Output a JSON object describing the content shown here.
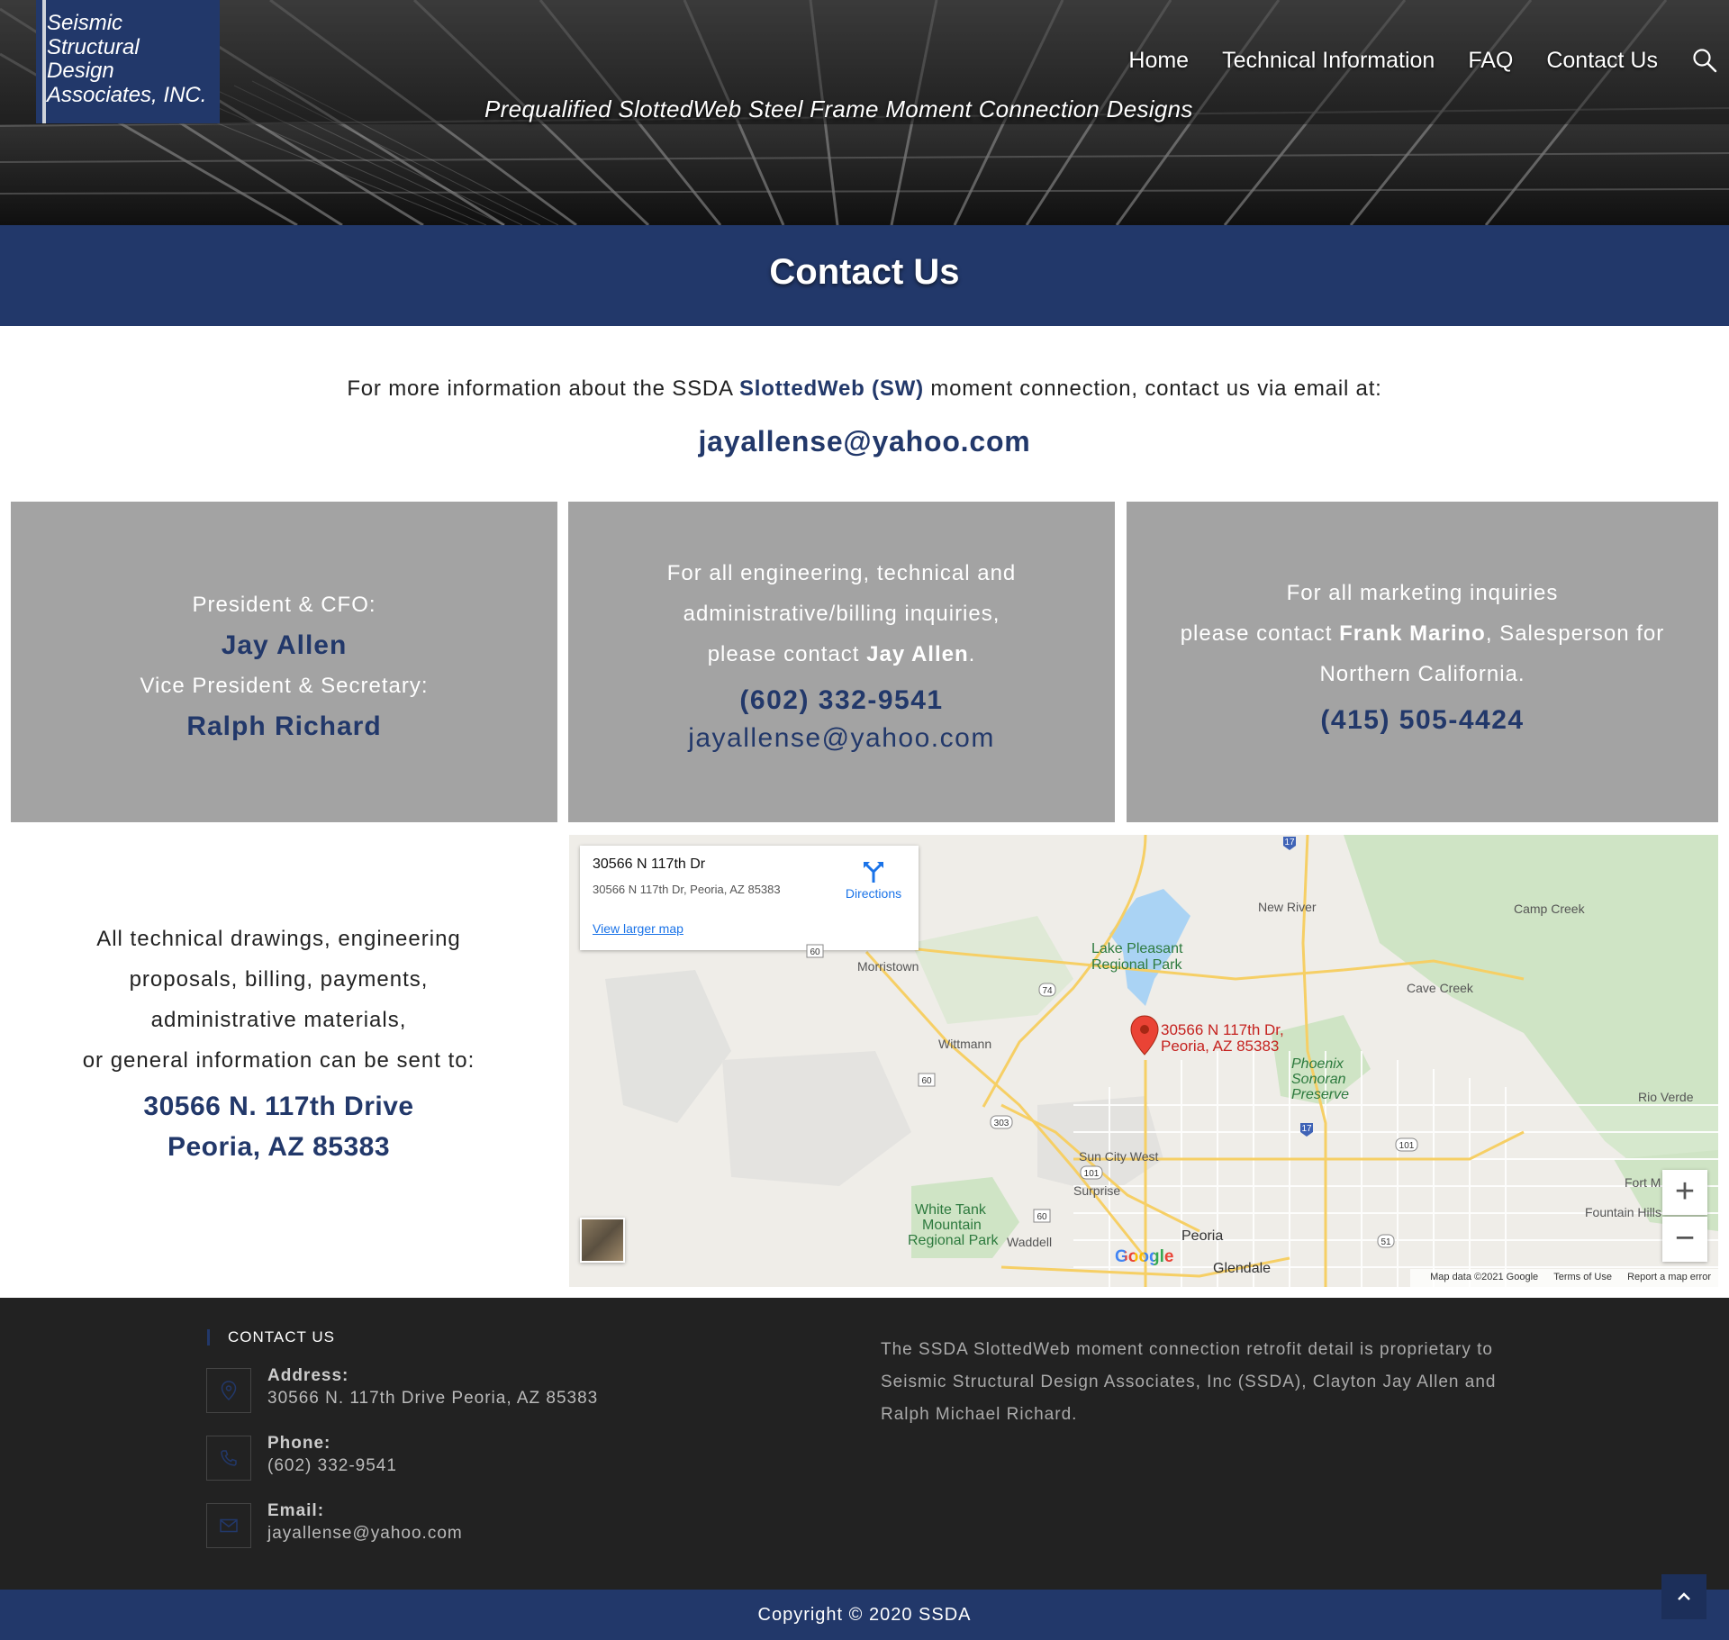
{
  "header": {
    "logo_lines": [
      {
        "initial": "S",
        "rest": "eismic"
      },
      {
        "initial": "S",
        "rest": "tructural"
      },
      {
        "initial": "D",
        "rest": "esign"
      },
      {
        "initial": "A",
        "rest": "ssociates, INC."
      }
    ],
    "nav": [
      "Home",
      "Technical Information",
      "FAQ",
      "Contact Us"
    ],
    "search_icon": "search-icon",
    "tagline": "Prequalified SlottedWeb Steel Frame Moment Connection Designs"
  },
  "page_title": "Contact Us",
  "intro": {
    "prefix": "For more information about the SSDA ",
    "brand": "SlottedWeb (SW)",
    "suffix": " moment connection, contact us via email at:",
    "email": "jayallense@yahoo.com"
  },
  "cards": {
    "officers": {
      "role1": "President & CFO:",
      "name1": "Jay Allen",
      "role2": "Vice President & Secretary:",
      "name2": "Ralph Richard"
    },
    "engineering": {
      "line1": "For all engineering, technical and",
      "line2": "administrative/billing inquiries,",
      "line3_prefix": "please contact ",
      "line3_name": "Jay Allen",
      "line3_suffix": ".",
      "phone": "(602) 332-9541",
      "email": "jayallense@yahoo.com"
    },
    "marketing": {
      "line1": "For all marketing inquiries",
      "line2_prefix": "please contact ",
      "line2_name": "Frank Marino",
      "line2_suffix": ", Salesperson for",
      "line3": "Northern California.",
      "phone": "(415) 505-4424"
    }
  },
  "mail": {
    "lines": [
      "All technical drawings, engineering",
      "proposals, billing, payments,",
      "administrative materials,",
      "or general information can be sent to:"
    ],
    "address1": "30566 N. 117th Drive",
    "address2": "Peoria, AZ 85383"
  },
  "map": {
    "info_title": "30566 N 117th Dr",
    "info_sub": "30566 N 117th Dr, Peoria, AZ 85383",
    "directions": "Directions",
    "larger": "View larger map",
    "marker_line1": "30566 N 117th Dr,",
    "marker_line2": "Peoria, AZ 85383",
    "labels": {
      "new_river": "New River",
      "camp_creek": "Camp Creek",
      "lake_pleasant_1": "Lake Pleasant",
      "lake_pleasant_2": "Regional Park",
      "morristown": "Morristown",
      "cave_creek": "Cave Creek",
      "wittmann": "Wittmann",
      "phoenix_1": "Phoenix",
      "phoenix_2": "Sonoran",
      "phoenix_3": "Preserve",
      "rio_verde": "Rio Verde",
      "sun_city_west": "Sun City West",
      "surprise": "Surprise",
      "fort_m": "Fort M",
      "fountain_hills": "Fountain Hills",
      "white_tank_1": "White Tank",
      "white_tank_2": "Mountain",
      "white_tank_3": "Regional Park",
      "waddell": "Waddell",
      "peoria": "Peoria",
      "glendale": "Glendale"
    },
    "shields": [
      "17",
      "74",
      "60",
      "303",
      "101",
      "17",
      "101",
      "60",
      "51",
      "60"
    ],
    "google": "Google",
    "map_data": "Map data ©2021 Google",
    "terms": "Terms of Use",
    "report": "Report a map error",
    "zoom_in": "+",
    "zoom_out": "−"
  },
  "footer": {
    "heading": "CONTACT US",
    "address_label": "Address:",
    "address": "30566 N. 117th Drive Peoria, AZ 85383",
    "phone_label": "Phone:",
    "phone": "(602) 332-9541",
    "email_label": "Email:",
    "email": "jayallense@yahoo.com",
    "about": "The SSDA SlottedWeb moment connection retrofit detail is proprietary to Seismic Structural Design Associates, Inc (SSDA), Clayton Jay Allen and Ralph Michael Richard.",
    "copyright": "Copyright © 2020 SSDA"
  },
  "colors": {
    "brand_navy": "#22386a",
    "card_gray": "#a3a3a3",
    "footer_dark": "#222222"
  }
}
